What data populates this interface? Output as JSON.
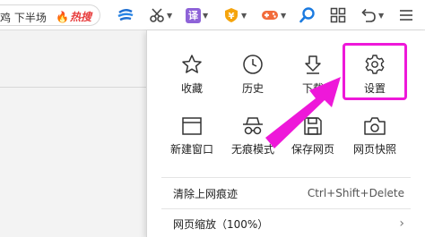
{
  "toolbar": {
    "search_snippet": "鸡 下半场",
    "hot_label": "热搜",
    "hot_flame": "🔥",
    "translate_label": "译",
    "extension_badge": "¥",
    "colors": {
      "hot": "#e73c3c",
      "translate": "#8e63d8",
      "extension": "#f5a40c",
      "accent": "#ee18d9"
    }
  },
  "menu": {
    "grid": [
      {
        "label": "收藏",
        "icon": "star-icon"
      },
      {
        "label": "历史",
        "icon": "clock-icon"
      },
      {
        "label": "下载",
        "icon": "download-icon"
      },
      {
        "label": "设置",
        "icon": "gear-icon"
      },
      {
        "label": "新建窗口",
        "icon": "window-icon"
      },
      {
        "label": "无痕模式",
        "icon": "incognito-icon"
      },
      {
        "label": "保存网页",
        "icon": "save-page-icon"
      },
      {
        "label": "网页快照",
        "icon": "camera-icon"
      }
    ],
    "rows": [
      {
        "label": "清除上网痕迹",
        "shortcut": "Ctrl+Shift+Delete"
      },
      {
        "label": "网页缩放（100%）",
        "chevron": "›"
      }
    ]
  }
}
